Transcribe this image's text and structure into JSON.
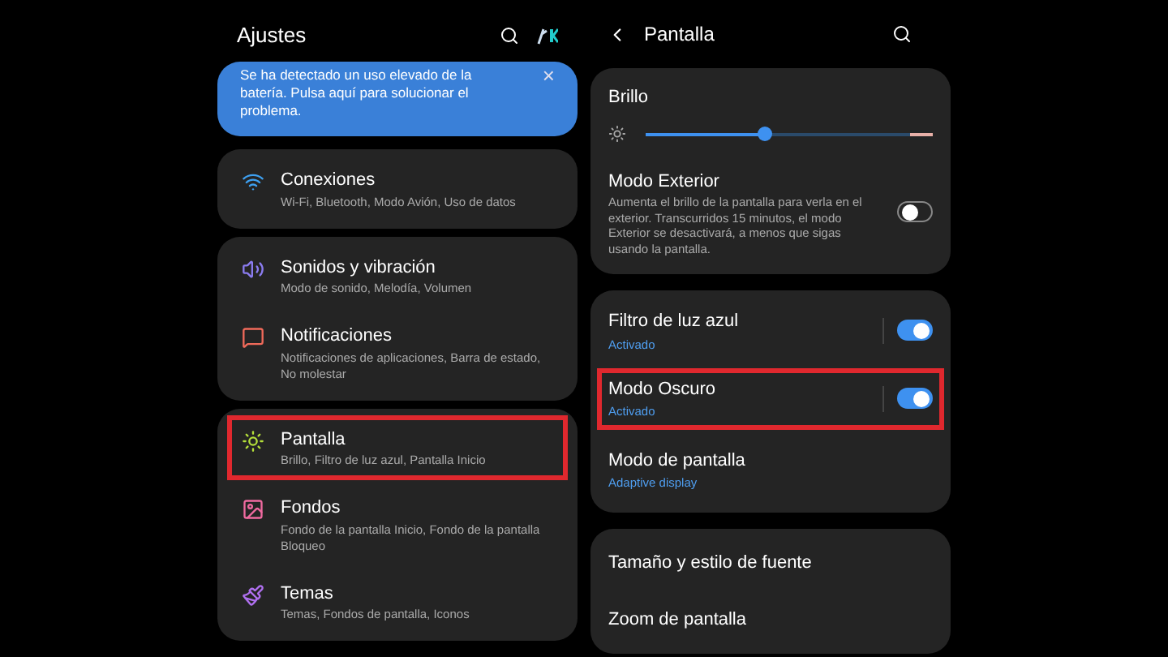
{
  "left": {
    "title": "Ajustes",
    "banner": {
      "text": "Se ha detectado un uso elevado de la batería. Pulsa aquí para solucionar el problema.",
      "close": "×"
    },
    "groups": [
      [
        {
          "title": "Conexiones",
          "subtitle": "Wi-Fi, Bluetooth, Modo Avión, Uso de datos",
          "highlighted": false
        }
      ],
      [
        {
          "title": "Sonidos y vibración",
          "subtitle": "Modo de sonido, Melodía, Volumen",
          "highlighted": false
        },
        {
          "title": "Notificaciones",
          "subtitle": "Notificaciones de aplicaciones, Barra de estado, No molestar",
          "highlighted": false
        }
      ],
      [
        {
          "title": "Pantalla",
          "subtitle": "Brillo, Filtro de luz azul, Pantalla Inicio",
          "highlighted": true
        },
        {
          "title": "Fondos",
          "subtitle": "Fondo de la pantalla Inicio, Fondo de la pantalla Bloqueo",
          "highlighted": false
        },
        {
          "title": "Temas",
          "subtitle": "Temas, Fondos de pantalla, Iconos",
          "highlighted": false
        }
      ]
    ]
  },
  "right": {
    "title": "Pantalla",
    "groups": [
      [
        {
          "kind": "slider",
          "title": "Brillo",
          "level": 0.45
        },
        {
          "kind": "toggle",
          "title": "Modo Exterior",
          "description": "Aumenta el brillo de la pantalla para verla en el exterior. Transcurridos 15 minutos, el modo Exterior se desactivará, a menos que sigas usando la pantalla.",
          "on": false,
          "highlighted": false
        }
      ],
      [
        {
          "kind": "toggle",
          "title": "Filtro de luz azul",
          "status": "Activado",
          "on": true,
          "highlighted": false
        },
        {
          "kind": "toggle",
          "title": "Modo Oscuro",
          "status": "Activado",
          "on": true,
          "highlighted": true
        },
        {
          "kind": "link",
          "title": "Modo de pantalla",
          "status": "Adaptive display",
          "highlighted": false
        }
      ],
      [
        {
          "kind": "link",
          "title": "Tamaño y estilo de fuente",
          "highlighted": false
        },
        {
          "kind": "link",
          "title": "Zoom de pantalla",
          "highlighted": false
        }
      ]
    ]
  }
}
